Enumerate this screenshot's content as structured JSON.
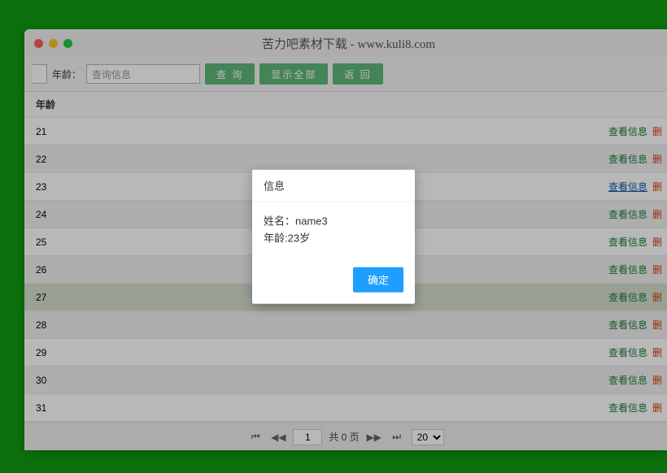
{
  "window": {
    "title": "苦力吧素材下载 - www.kuli8.com"
  },
  "toolbar": {
    "age_label": "年龄：",
    "search_placeholder": "查询信息",
    "btn_search": "查 询",
    "btn_all": "显示全部",
    "btn_back": "返 回"
  },
  "table": {
    "header_age": "年龄",
    "rows": [
      {
        "age": "21"
      },
      {
        "age": "22"
      },
      {
        "age": "23"
      },
      {
        "age": "24"
      },
      {
        "age": "25"
      },
      {
        "age": "26"
      },
      {
        "age": "27"
      },
      {
        "age": "28"
      },
      {
        "age": "29"
      },
      {
        "age": "30"
      },
      {
        "age": "31"
      }
    ],
    "link_view": "查看信息",
    "link_delete": "删"
  },
  "pager": {
    "page": "1",
    "total_text": "共 0 页",
    "page_size": "20"
  },
  "modal": {
    "title": "信息",
    "line1": "姓名：name3",
    "line2": "年龄:23岁",
    "ok": "确定"
  }
}
